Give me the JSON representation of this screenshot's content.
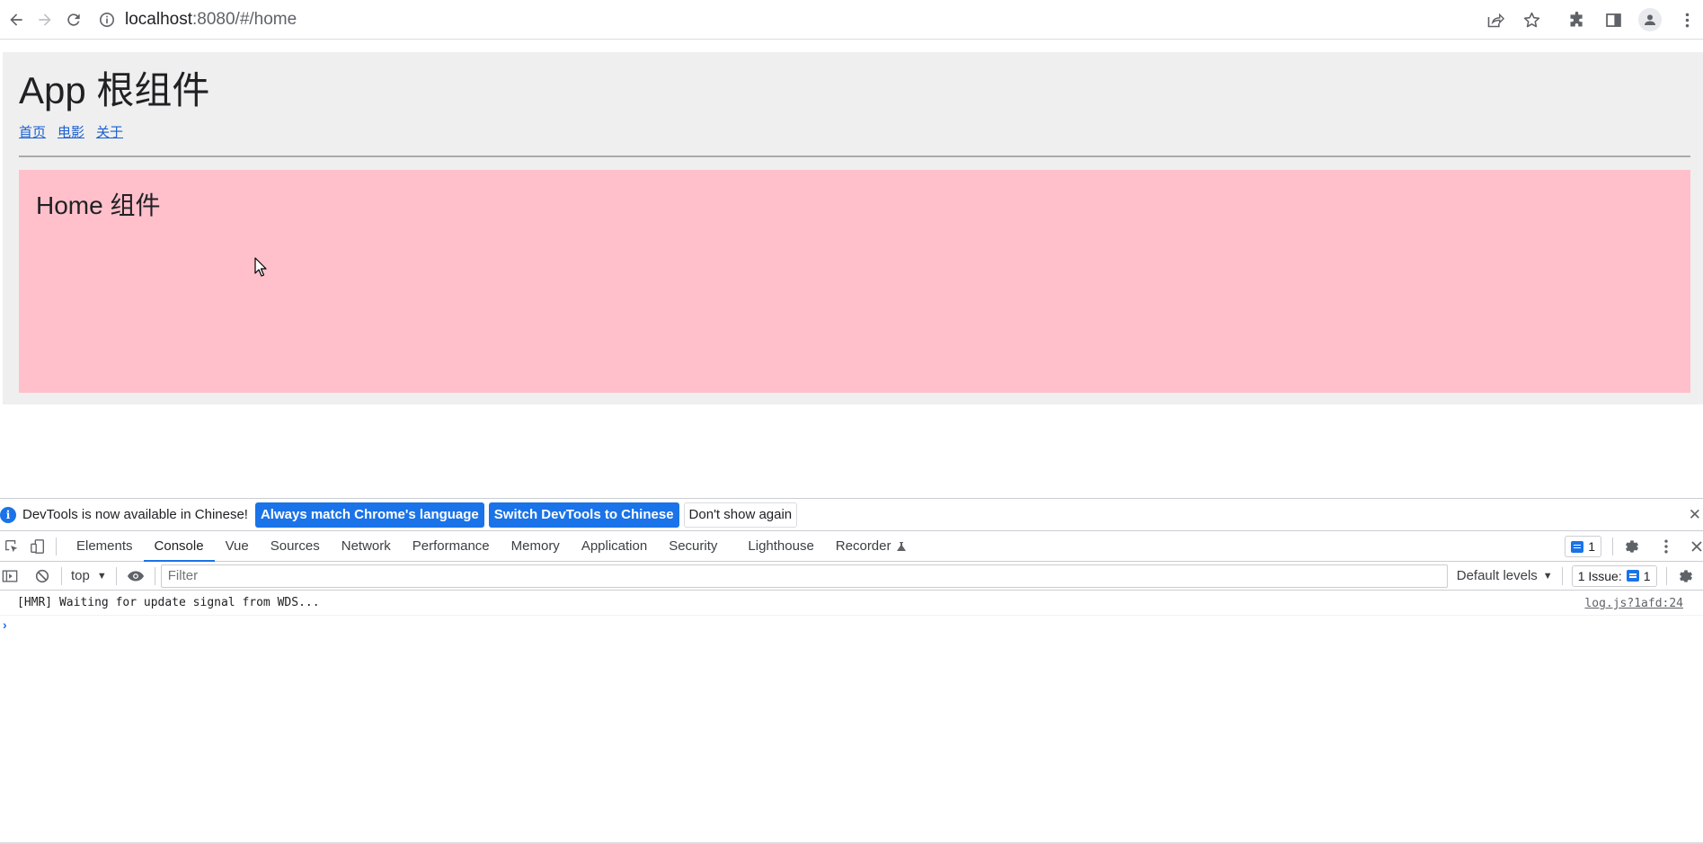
{
  "browser": {
    "url_host": "localhost",
    "url_rest": ":8080/#/home"
  },
  "app": {
    "title": "App 根组件",
    "nav": [
      "首页",
      "电影",
      "关于"
    ],
    "home_title": "Home 组件"
  },
  "devtools": {
    "notice_text": "DevTools is now available in Chinese!",
    "btn_match": "Always match Chrome's language",
    "btn_switch": "Switch DevTools to Chinese",
    "btn_dismiss": "Don't show again",
    "tabs": [
      "Elements",
      "Console",
      "Vue",
      "Sources",
      "Network",
      "Performance",
      "Memory",
      "Application",
      "Security",
      "Lighthouse",
      "Recorder"
    ],
    "active_tab": "Console",
    "issue_badge_count": "1",
    "context": "top",
    "filter_placeholder": "Filter",
    "levels": "Default levels",
    "issues_label": "1 Issue:",
    "issues_count": "1",
    "log_message": "[HMR] Waiting for update signal from WDS...",
    "log_source": "log.js?1afd:24",
    "prompt_symbol": "›"
  },
  "colors": {
    "accent": "#1a73e8",
    "app_bg": "#efefef",
    "home_bg": "#ffc0cb",
    "link": "#1a5fd0"
  }
}
